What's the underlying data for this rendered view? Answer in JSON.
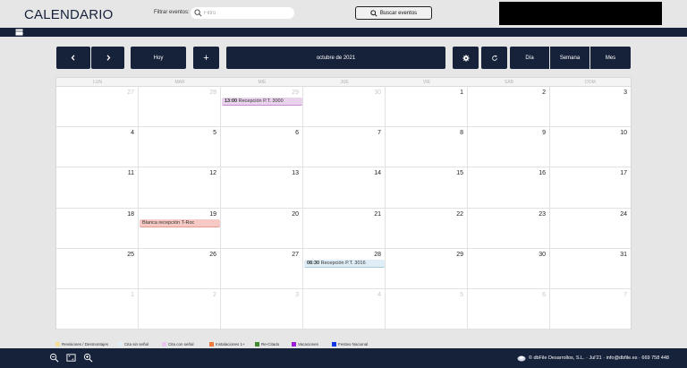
{
  "header": {
    "title": "CALENDARIO",
    "filter_label": "Filtrar eventos:",
    "filter_placeholder": "Filtro",
    "search_button": "Buscar eventos"
  },
  "toolbar": {
    "today": "Hoy",
    "add": "+",
    "period": "octubre de 2021",
    "views": [
      "Día",
      "Semana",
      "Mes"
    ]
  },
  "calendar": {
    "weekdays": [
      "LUN",
      "MAR",
      "MIÉ",
      "JUE",
      "VIE",
      "SÁB",
      "DOM"
    ],
    "weeks": [
      [
        {
          "d": "27",
          "o": true
        },
        {
          "d": "28",
          "o": true
        },
        {
          "d": "29",
          "o": true
        },
        {
          "d": "30",
          "o": true
        },
        {
          "d": "1"
        },
        {
          "d": "2"
        },
        {
          "d": "3"
        }
      ],
      [
        {
          "d": "4"
        },
        {
          "d": "5"
        },
        {
          "d": "6"
        },
        {
          "d": "7"
        },
        {
          "d": "8"
        },
        {
          "d": "9"
        },
        {
          "d": "10"
        }
      ],
      [
        {
          "d": "11"
        },
        {
          "d": "12"
        },
        {
          "d": "13"
        },
        {
          "d": "14"
        },
        {
          "d": "15"
        },
        {
          "d": "16"
        },
        {
          "d": "17"
        }
      ],
      [
        {
          "d": "18"
        },
        {
          "d": "19"
        },
        {
          "d": "20"
        },
        {
          "d": "21"
        },
        {
          "d": "22"
        },
        {
          "d": "23"
        },
        {
          "d": "24"
        }
      ],
      [
        {
          "d": "25"
        },
        {
          "d": "26"
        },
        {
          "d": "27"
        },
        {
          "d": "28"
        },
        {
          "d": "29"
        },
        {
          "d": "30"
        },
        {
          "d": "31"
        }
      ],
      [
        {
          "d": "1",
          "o": true
        },
        {
          "d": "2",
          "o": true
        },
        {
          "d": "3",
          "o": true
        },
        {
          "d": "4",
          "o": true
        },
        {
          "d": "5",
          "o": true
        },
        {
          "d": "6",
          "o": true
        },
        {
          "d": "7",
          "o": true
        }
      ]
    ],
    "events": [
      {
        "week": 0,
        "day": 2,
        "time": "13:00",
        "title": "Recepción P.T. 3000",
        "color": "#e9d2ec",
        "border": "#c98bd1"
      },
      {
        "week": 3,
        "day": 1,
        "time": "",
        "title": "Blanca recepción T-Roc",
        "color": "#f6c9c4",
        "border": "#e59a92"
      },
      {
        "week": 4,
        "day": 3,
        "time": "08:30",
        "title": "Recepción P.T. 3016",
        "color": "#dfeef6",
        "border": "#a6cde0"
      }
    ]
  },
  "legend": [
    {
      "label": "Revisiones / Desmontajes",
      "color": "#f5df9b"
    },
    {
      "label": "Cita sin señal",
      "color": "#dfeef6"
    },
    {
      "label": "Cita con señal",
      "color": "#e9c7ef"
    },
    {
      "label": "Instalaciones 1+",
      "color": "#f07a3a"
    },
    {
      "label": "Re-Citado",
      "color": "#3f8a2c"
    },
    {
      "label": "Vacaciones",
      "color": "#9b1fd6"
    },
    {
      "label": "Festivo Nacional",
      "color": "#1036e6"
    }
  ],
  "footer": {
    "credits": "© dbFile Desarrollos, S.L. · Jul'21 · info@dbfile.es · 669 758 448"
  }
}
